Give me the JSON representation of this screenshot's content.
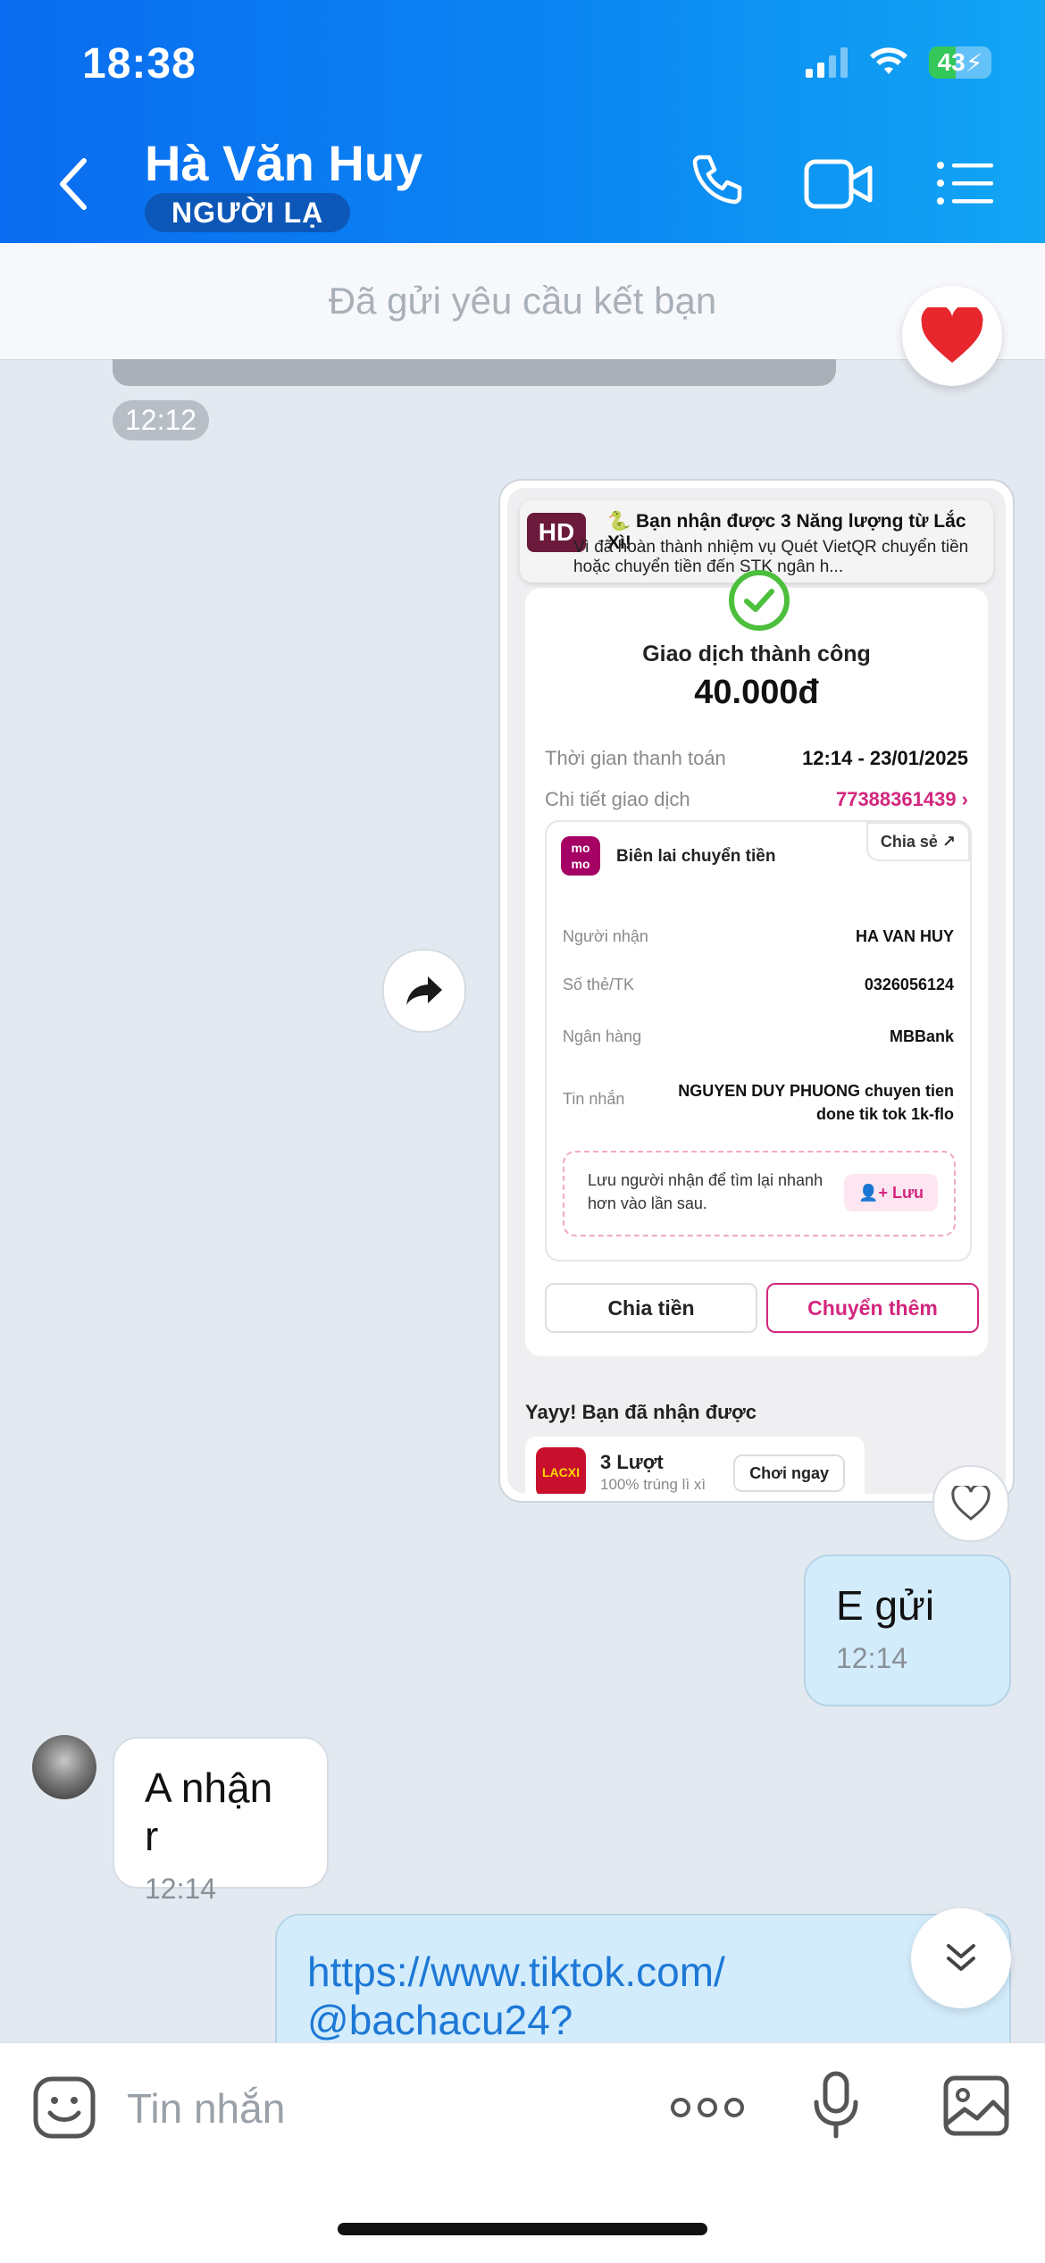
{
  "status_bar": {
    "time": "18:38",
    "battery": "43"
  },
  "header": {
    "name": "Hà Văn Huy",
    "badge": "NGƯỜI LẠ"
  },
  "banner": {
    "text": "Đã gửi yêu cầu kết bạn"
  },
  "messages": {
    "first_time": "12:12",
    "receipt": {
      "notif_title": "🐍 Bạn nhận được 3 Năng lượng từ Lắc Xì!",
      "notif_body": "Vì đã hoàn thành nhiệm vụ  Quét VietQR chuyển tiền hoặc chuyển tiền đến STK ngân h...",
      "hd_badge": "HD",
      "status": "Giao dịch thành công",
      "amount": "40.000đ",
      "rows": [
        {
          "label": "Thời gian thanh toán",
          "value": "12:14 - 23/01/2025"
        },
        {
          "label": "Chi tiết giao dịch",
          "value": "77388361439 ›"
        }
      ],
      "logo": "mo mo",
      "receipt_title": "Biên lai chuyển tiền",
      "share": "Chia sẻ ↗",
      "details": [
        {
          "label": "Người nhận",
          "value": "HA VAN HUY"
        },
        {
          "label": "Số thẻ/TK",
          "value": "0326056124"
        },
        {
          "label": "Ngân hàng",
          "value": "MBBank"
        },
        {
          "label": "Tin nhắn",
          "value": "NGUYEN DUY PHUONG chuyen tien done tik tok 1k-flo"
        }
      ],
      "save_text": "Lưu người nhận để tìm lại nhanh hơn vào lần sau.",
      "save_btn": "Lưu",
      "btn_split": "Chia tiền",
      "btn_more": "Chuyển thêm",
      "yay": "Yayy! Bạn đã nhận được",
      "game_title": "3 Lượt",
      "game_sub": "100% trúng lì xì",
      "game_btn": "Chơi ngay",
      "game_icon": "LACXI"
    },
    "sent1": {
      "text": "E gửi",
      "time": "12:14"
    },
    "received1": {
      "text": "A nhận r",
      "time": "12:14"
    },
    "sent2": {
      "text": "https://www.tiktok.com/ @bachacu24?"
    }
  },
  "input": {
    "placeholder": "Tin nhắn"
  },
  "colors": {
    "header": "#0b86f2",
    "accent_pink": "#d3267d",
    "sent_bubble": "#d3ecfb"
  }
}
